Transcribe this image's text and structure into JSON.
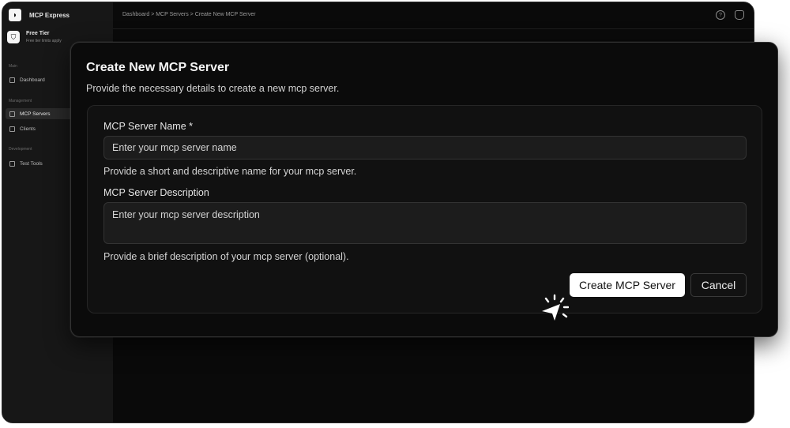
{
  "app": {
    "name": "MCP Express",
    "tier": {
      "title": "Free Tier",
      "subtitle": "Free tier limits apply"
    },
    "sections": [
      {
        "label": "Main",
        "items": [
          {
            "label": "Dashboard",
            "icon": "home-icon"
          }
        ]
      },
      {
        "label": "Management",
        "items": [
          {
            "label": "MCP Servers",
            "icon": "server-icon",
            "active": true
          },
          {
            "label": "Clients",
            "icon": "users-icon"
          }
        ]
      },
      {
        "label": "Development",
        "items": [
          {
            "label": "Test Tools",
            "icon": "grid-icon"
          }
        ]
      }
    ],
    "breadcrumb": "Dashboard > MCP Servers > Create New MCP Server"
  },
  "modal": {
    "title": "Create New MCP Server",
    "description": "Provide the necessary details to create a new mcp server.",
    "name_label": "MCP Server Name *",
    "name_placeholder": "Enter your mcp server name",
    "name_help": "Provide a short and descriptive name for your mcp server.",
    "desc_label": "MCP Server Description",
    "desc_placeholder": "Enter your mcp server description",
    "desc_help": "Provide a brief description of your mcp server (optional).",
    "create_button": "Create MCP Server",
    "cancel_button": "Cancel"
  },
  "colors": {
    "modal_bg": "#0b0b0b",
    "card_bg": "#111111",
    "primary_btn": "#ffffff"
  }
}
